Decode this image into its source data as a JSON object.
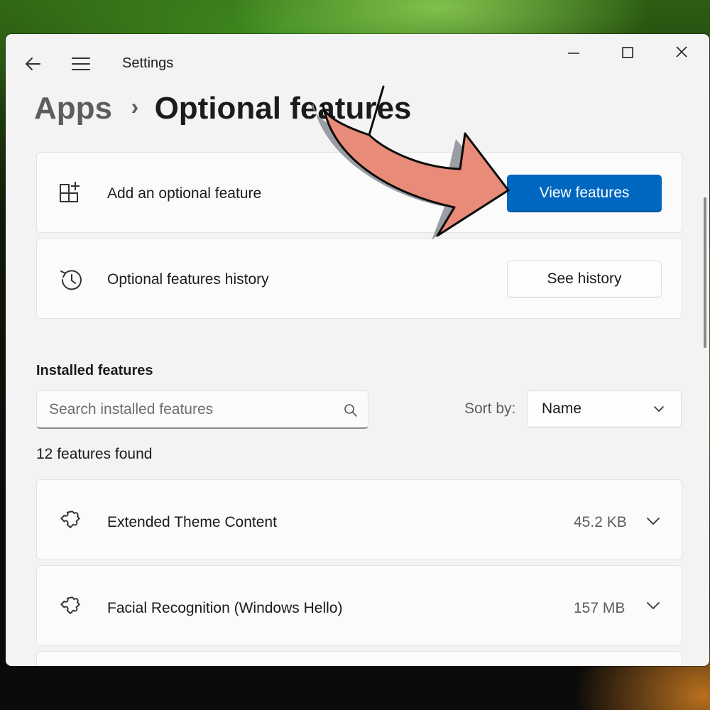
{
  "window": {
    "title": "Settings",
    "controls": {
      "minimize": "minimize-icon",
      "maximize": "maximize-icon",
      "close": "close-icon"
    }
  },
  "breadcrumb": {
    "parent": "Apps",
    "separator": "›",
    "current": "Optional features"
  },
  "add_feature": {
    "label": "Add an optional feature",
    "button": "View features",
    "icon": "add-grid-icon"
  },
  "history": {
    "label": "Optional features history",
    "button": "See history",
    "icon": "history-icon"
  },
  "installed": {
    "title": "Installed features",
    "search_placeholder": "Search installed features",
    "sort_label": "Sort by:",
    "sort_value": "Name",
    "count_text": "12 features found",
    "items": [
      {
        "name": "Extended Theme Content",
        "size": "45.2 KB",
        "icon": "puzzle-icon"
      },
      {
        "name": "Facial Recognition (Windows Hello)",
        "size": "157 MB",
        "icon": "puzzle-icon"
      }
    ]
  },
  "colors": {
    "accent": "#0067c0",
    "annotation_arrow": "#e88b78",
    "window_bg": "#f3f3f3",
    "card_bg": "#fbfbfb"
  }
}
